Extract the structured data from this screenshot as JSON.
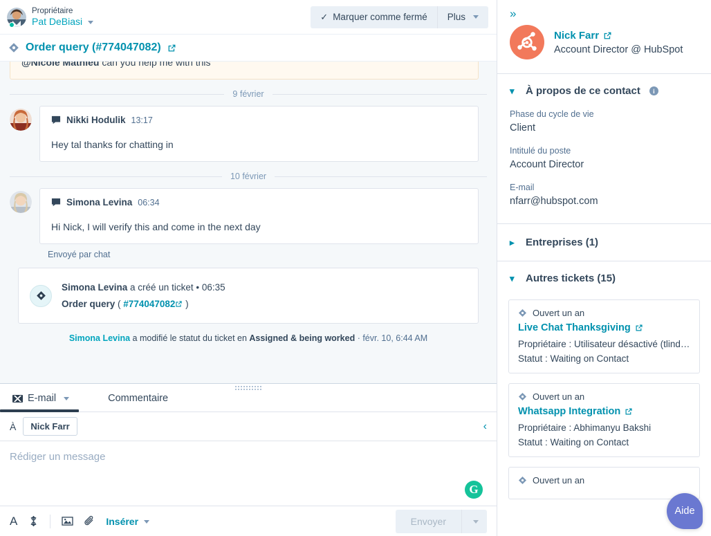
{
  "header": {
    "owner_label": "Propriétaire",
    "owner_name": "Pat DeBiasi",
    "mark_closed_label": "Marquer comme fermé",
    "more_label": "Plus"
  },
  "ticket_bar": {
    "title": "Order query (#774047082)"
  },
  "thread": {
    "clipped_message": {
      "mention": "@Nicole Mathieu",
      "text": " can you help me with this"
    },
    "days": [
      {
        "label": "9 février"
      },
      {
        "label": "10 février"
      }
    ],
    "messages": [
      {
        "sender": "Nikki Hodulik",
        "time": "13:17",
        "body": "Hey tal thanks for chatting in"
      },
      {
        "sender": "Simona Levina",
        "time": "06:34",
        "body": "Hi Nick, I will verify this and come in the next day"
      }
    ],
    "sent_via": "Envoyé par chat",
    "event": {
      "actor": "Simona Levina",
      "action": " a créé un ticket • ",
      "time": "06:35",
      "ticket_name": "Order query",
      "ticket_open_paren": "( ",
      "ticket_id": "#774047082",
      "ticket_close_paren": " )"
    },
    "status_change": {
      "actor": "Simona Levina",
      "mid": " a modifié le statut du ticket en ",
      "new_status": "Assigned & being worked",
      "timestamp": " · févr. 10, 6:44 AM"
    }
  },
  "composer": {
    "tabs": [
      {
        "label": "E-mail",
        "active": true
      },
      {
        "label": "Commentaire",
        "active": false
      }
    ],
    "to_label": "À",
    "recipient": "Nick Farr",
    "editor_placeholder": "Rédiger un message",
    "grammarly_glyph": "G",
    "toolbar": {
      "font_glyph": "A",
      "insert_label": "Insérer"
    },
    "send_label": "Envoyer"
  },
  "sidebar": {
    "contact": {
      "name": "Nick Farr",
      "subtitle": "Account Director @ HubSpot"
    },
    "about_section": {
      "title": "À propos de ce contact",
      "properties": [
        {
          "label": "Phase du cycle de vie",
          "value": "Client"
        },
        {
          "label": "Intitulé du poste",
          "value": "Account Director"
        },
        {
          "label": "E-mail",
          "value": "nfarr@hubspot.com"
        }
      ]
    },
    "companies_section": {
      "title": "Entreprises (1)"
    },
    "tickets_section": {
      "title": "Autres tickets (15)",
      "cards": [
        {
          "age": "Ouvert un an",
          "title": "Live Chat Thanksgiving",
          "owner": "Propriétaire : Utilisateur désactivé (tlindley@h…",
          "status": "Statut : Waiting on Contact"
        },
        {
          "age": "Ouvert un an",
          "title": "Whatsapp Integration",
          "owner": "Propriétaire : Abhimanyu Bakshi",
          "status": "Statut : Waiting on Contact"
        },
        {
          "age": "Ouvert un an",
          "title": "",
          "owner": "",
          "status": ""
        }
      ]
    },
    "help_label": "Aide"
  },
  "colors": {
    "teal_link": "#0091ae",
    "cyan_link": "#00a4bd",
    "navy_text": "#33475b",
    "hubspot_orange": "#f2795b",
    "grammarly_green": "#15c39a",
    "help_purple": "#6a78d1",
    "thread_bg": "#f5f8fa",
    "border": "#dfe3eb"
  }
}
